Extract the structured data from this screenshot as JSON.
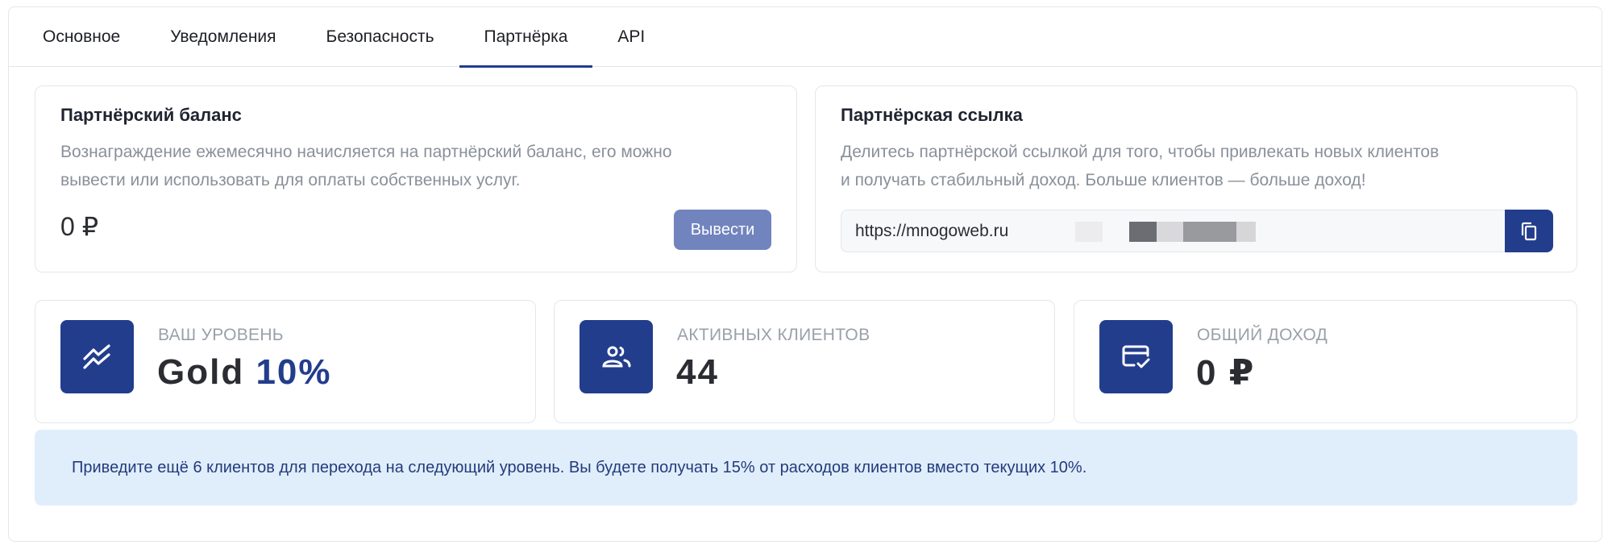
{
  "tabs": [
    {
      "label": "Основное",
      "active": false
    },
    {
      "label": "Уведомления",
      "active": false
    },
    {
      "label": "Безопасность",
      "active": false
    },
    {
      "label": "Партнёрка",
      "active": true
    },
    {
      "label": "API",
      "active": false
    }
  ],
  "balance": {
    "title": "Партнёрский баланс",
    "description_line1": "Вознаграждение ежемесячно начисляется на партнёрский баланс, его можно",
    "description_line2": "вывести или использовать для оплаты собственных услуг.",
    "amount": "0 ₽",
    "withdraw_label": "Вывести"
  },
  "link": {
    "title": "Партнёрская ссылка",
    "description_line1": "Делитесь партнёрской ссылкой для того, чтобы привлекать новых клиентов",
    "description_line2": "и получать стабильный доход. Больше клиентов — больше доход!",
    "url_visible": "https://mnogoweb.ru",
    "copy_icon": "copy-icon"
  },
  "stats": [
    {
      "label": "ВАШ УРОВЕНЬ",
      "value": "Gold",
      "accent": "10%",
      "icon": "trend-icon"
    },
    {
      "label": "АКТИВНЫХ КЛИЕНТОВ",
      "value": "44",
      "icon": "users-icon"
    },
    {
      "label": "ОБЩИЙ ДОХОД",
      "value": "0 ₽",
      "icon": "card-check-icon"
    }
  ],
  "banner": {
    "text": "Приведите ещё 6 клиентов для перехода на следующий уровень. Вы будете получать 15% от расходов клиентов вместо текущих 10%."
  },
  "colors": {
    "primary": "#233d8d",
    "button_muted": "#7184bd",
    "banner_bg": "#e0eefc",
    "banner_text": "#233b7a"
  }
}
